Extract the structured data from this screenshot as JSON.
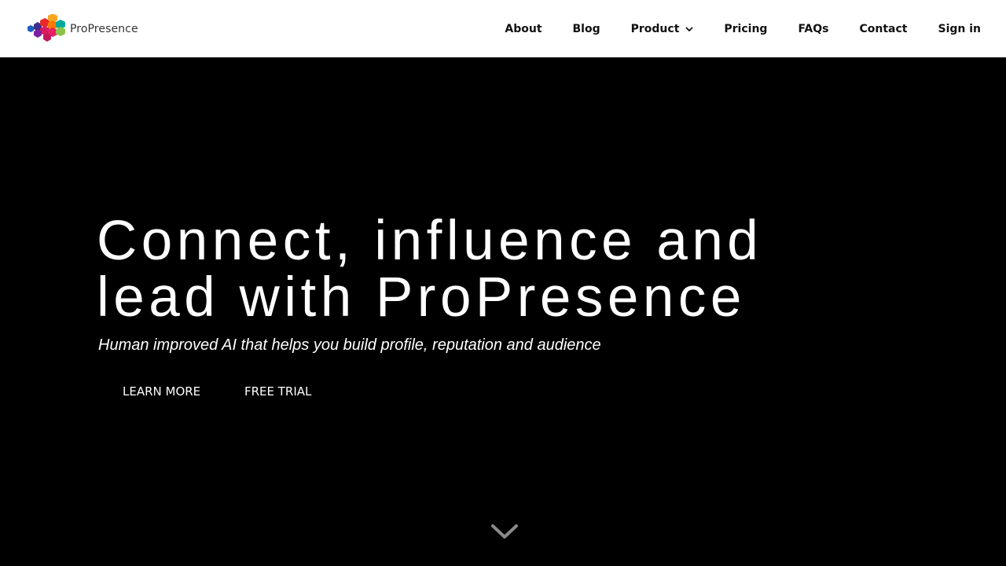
{
  "header": {
    "logo": {
      "text": "ProPresence",
      "icon": "hexagon-cluster-logo"
    },
    "nav": [
      {
        "label": "About"
      },
      {
        "label": "Blog"
      },
      {
        "label": "Product",
        "icon": "chevron-down-icon"
      },
      {
        "label": "Pricing"
      },
      {
        "label": "FAQs"
      },
      {
        "label": "Contact"
      },
      {
        "label": "Sign in"
      }
    ]
  },
  "hero": {
    "headline_line1": "Connect, influence and",
    "headline_line2": "lead with ProPresence",
    "subheadline": "Human improved AI that helps you build profile, reputation and audience",
    "learn_more_label": "LEARN MORE",
    "free_trial_label": "FREE TRIAL",
    "scroll_icon": "chevron-down-icon"
  },
  "colors": {
    "hero_background": "#000000",
    "header_background": "#ffffff",
    "nav_text": "#111111",
    "hero_text": "#ffffff"
  }
}
